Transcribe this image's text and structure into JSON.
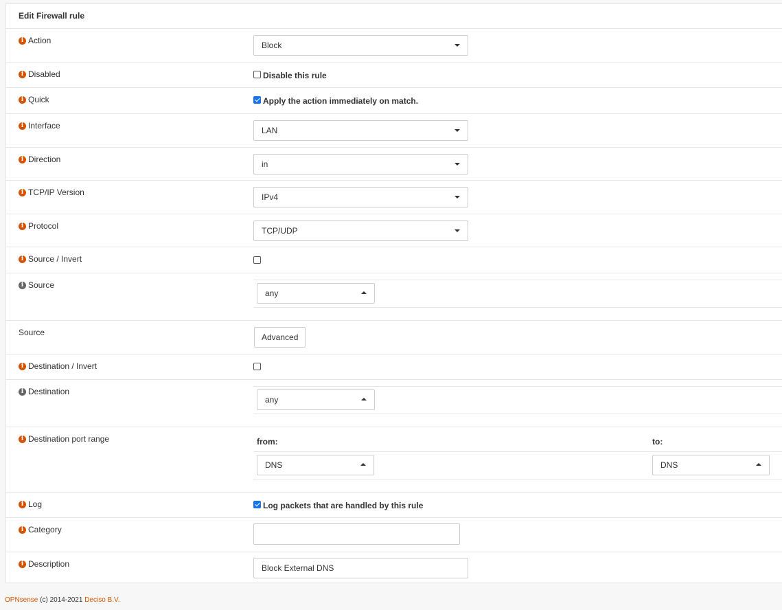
{
  "panel": {
    "title": "Edit Firewall rule"
  },
  "rows": {
    "action": {
      "label": "Action",
      "value": "Block"
    },
    "disabled": {
      "label": "Disabled",
      "checkbox_label": "Disable this rule",
      "checked": false
    },
    "quick": {
      "label": "Quick",
      "checkbox_label": "Apply the action immediately on match.",
      "checked": true
    },
    "interface": {
      "label": "Interface",
      "value": "LAN"
    },
    "direction": {
      "label": "Direction",
      "value": "in"
    },
    "tcpip": {
      "label": "TCP/IP Version",
      "value": "IPv4"
    },
    "protocol": {
      "label": "Protocol",
      "value": "TCP/UDP"
    },
    "source_invert": {
      "label": "Source / Invert",
      "checked": false
    },
    "source": {
      "label": "Source",
      "value": "any"
    },
    "source_adv": {
      "label": "Source",
      "button": "Advanced"
    },
    "dest_invert": {
      "label": "Destination / Invert",
      "checked": false
    },
    "destination": {
      "label": "Destination",
      "value": "any"
    },
    "dest_port": {
      "label": "Destination port range",
      "from_label": "from:",
      "to_label": "to:",
      "from_value": "DNS",
      "to_value": "DNS"
    },
    "log": {
      "label": "Log",
      "checkbox_label": "Log packets that are handled by this rule",
      "checked": true
    },
    "category": {
      "label": "Category",
      "value": ""
    },
    "description": {
      "label": "Description",
      "value": "Block External DNS"
    }
  },
  "footer": {
    "brand": "OPNsense",
    "copyright": "(c) 2014-2021",
    "company": "Deciso B.V."
  },
  "colors": {
    "accent": "#d35400",
    "checkbox": "#1a73e8"
  },
  "icons": {
    "info": "info-circle-icon",
    "caret_down": "caret-down-icon",
    "caret_up": "caret-up-icon"
  }
}
